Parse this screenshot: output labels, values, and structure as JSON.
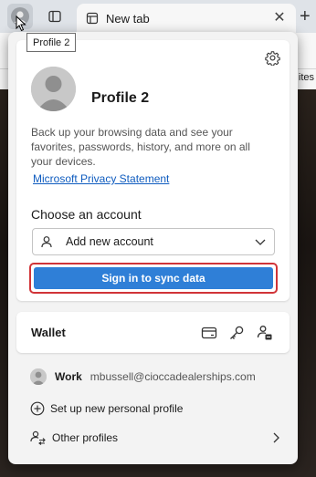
{
  "tab": {
    "title": "New tab",
    "close_glyph": "✕",
    "new_glyph": "+"
  },
  "favorites_partial": "ites",
  "tooltip": "Profile 2",
  "profile": {
    "name": "Profile 2",
    "backup_text": "Back up your browsing data and see your favorites, passwords, history, and more on all your devices.",
    "privacy_link": "Microsoft Privacy Statement",
    "choose_label": "Choose an account",
    "add_account_option": "Add new account",
    "sync_button": "Sign in to sync data"
  },
  "wallet": {
    "title": "Wallet"
  },
  "other_profiles": {
    "work_label": "Work",
    "work_email": "mbussell@cioccadealerships.com",
    "new_profile": "Set up new personal profile",
    "other_profiles": "Other profiles"
  },
  "colors": {
    "accent": "#2f7fd7",
    "highlight_outline": "#d13438",
    "link": "#0f5cbf"
  },
  "icons": {
    "settings": "gear-icon",
    "add_account": "person-icon",
    "dropdown": "chevron-down-icon",
    "wallet_card": "credit-card-icon",
    "wallet_password": "key-icon",
    "wallet_personal": "person-badge-icon",
    "new_profile": "add-circle-icon",
    "other_profiles": "people-switch-icon"
  }
}
